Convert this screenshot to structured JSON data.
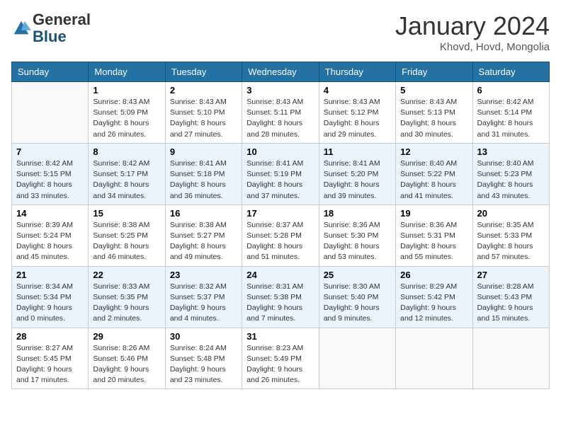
{
  "header": {
    "logo_general": "General",
    "logo_blue": "Blue",
    "month_title": "January 2024",
    "location": "Khovd, Hovd, Mongolia"
  },
  "days_of_week": [
    "Sunday",
    "Monday",
    "Tuesday",
    "Wednesday",
    "Thursday",
    "Friday",
    "Saturday"
  ],
  "weeks": [
    [
      {
        "day": "",
        "sunrise": "",
        "sunset": "",
        "daylight": ""
      },
      {
        "day": "1",
        "sunrise": "Sunrise: 8:43 AM",
        "sunset": "Sunset: 5:09 PM",
        "daylight": "Daylight: 8 hours and 26 minutes."
      },
      {
        "day": "2",
        "sunrise": "Sunrise: 8:43 AM",
        "sunset": "Sunset: 5:10 PM",
        "daylight": "Daylight: 8 hours and 27 minutes."
      },
      {
        "day": "3",
        "sunrise": "Sunrise: 8:43 AM",
        "sunset": "Sunset: 5:11 PM",
        "daylight": "Daylight: 8 hours and 28 minutes."
      },
      {
        "day": "4",
        "sunrise": "Sunrise: 8:43 AM",
        "sunset": "Sunset: 5:12 PM",
        "daylight": "Daylight: 8 hours and 29 minutes."
      },
      {
        "day": "5",
        "sunrise": "Sunrise: 8:43 AM",
        "sunset": "Sunset: 5:13 PM",
        "daylight": "Daylight: 8 hours and 30 minutes."
      },
      {
        "day": "6",
        "sunrise": "Sunrise: 8:42 AM",
        "sunset": "Sunset: 5:14 PM",
        "daylight": "Daylight: 8 hours and 31 minutes."
      }
    ],
    [
      {
        "day": "7",
        "sunrise": "Sunrise: 8:42 AM",
        "sunset": "Sunset: 5:15 PM",
        "daylight": "Daylight: 8 hours and 33 minutes."
      },
      {
        "day": "8",
        "sunrise": "Sunrise: 8:42 AM",
        "sunset": "Sunset: 5:17 PM",
        "daylight": "Daylight: 8 hours and 34 minutes."
      },
      {
        "day": "9",
        "sunrise": "Sunrise: 8:41 AM",
        "sunset": "Sunset: 5:18 PM",
        "daylight": "Daylight: 8 hours and 36 minutes."
      },
      {
        "day": "10",
        "sunrise": "Sunrise: 8:41 AM",
        "sunset": "Sunset: 5:19 PM",
        "daylight": "Daylight: 8 hours and 37 minutes."
      },
      {
        "day": "11",
        "sunrise": "Sunrise: 8:41 AM",
        "sunset": "Sunset: 5:20 PM",
        "daylight": "Daylight: 8 hours and 39 minutes."
      },
      {
        "day": "12",
        "sunrise": "Sunrise: 8:40 AM",
        "sunset": "Sunset: 5:22 PM",
        "daylight": "Daylight: 8 hours and 41 minutes."
      },
      {
        "day": "13",
        "sunrise": "Sunrise: 8:40 AM",
        "sunset": "Sunset: 5:23 PM",
        "daylight": "Daylight: 8 hours and 43 minutes."
      }
    ],
    [
      {
        "day": "14",
        "sunrise": "Sunrise: 8:39 AM",
        "sunset": "Sunset: 5:24 PM",
        "daylight": "Daylight: 8 hours and 45 minutes."
      },
      {
        "day": "15",
        "sunrise": "Sunrise: 8:38 AM",
        "sunset": "Sunset: 5:25 PM",
        "daylight": "Daylight: 8 hours and 46 minutes."
      },
      {
        "day": "16",
        "sunrise": "Sunrise: 8:38 AM",
        "sunset": "Sunset: 5:27 PM",
        "daylight": "Daylight: 8 hours and 49 minutes."
      },
      {
        "day": "17",
        "sunrise": "Sunrise: 8:37 AM",
        "sunset": "Sunset: 5:28 PM",
        "daylight": "Daylight: 8 hours and 51 minutes."
      },
      {
        "day": "18",
        "sunrise": "Sunrise: 8:36 AM",
        "sunset": "Sunset: 5:30 PM",
        "daylight": "Daylight: 8 hours and 53 minutes."
      },
      {
        "day": "19",
        "sunrise": "Sunrise: 8:36 AM",
        "sunset": "Sunset: 5:31 PM",
        "daylight": "Daylight: 8 hours and 55 minutes."
      },
      {
        "day": "20",
        "sunrise": "Sunrise: 8:35 AM",
        "sunset": "Sunset: 5:33 PM",
        "daylight": "Daylight: 8 hours and 57 minutes."
      }
    ],
    [
      {
        "day": "21",
        "sunrise": "Sunrise: 8:34 AM",
        "sunset": "Sunset: 5:34 PM",
        "daylight": "Daylight: 9 hours and 0 minutes."
      },
      {
        "day": "22",
        "sunrise": "Sunrise: 8:33 AM",
        "sunset": "Sunset: 5:35 PM",
        "daylight": "Daylight: 9 hours and 2 minutes."
      },
      {
        "day": "23",
        "sunrise": "Sunrise: 8:32 AM",
        "sunset": "Sunset: 5:37 PM",
        "daylight": "Daylight: 9 hours and 4 minutes."
      },
      {
        "day": "24",
        "sunrise": "Sunrise: 8:31 AM",
        "sunset": "Sunset: 5:38 PM",
        "daylight": "Daylight: 9 hours and 7 minutes."
      },
      {
        "day": "25",
        "sunrise": "Sunrise: 8:30 AM",
        "sunset": "Sunset: 5:40 PM",
        "daylight": "Daylight: 9 hours and 9 minutes."
      },
      {
        "day": "26",
        "sunrise": "Sunrise: 8:29 AM",
        "sunset": "Sunset: 5:42 PM",
        "daylight": "Daylight: 9 hours and 12 minutes."
      },
      {
        "day": "27",
        "sunrise": "Sunrise: 8:28 AM",
        "sunset": "Sunset: 5:43 PM",
        "daylight": "Daylight: 9 hours and 15 minutes."
      }
    ],
    [
      {
        "day": "28",
        "sunrise": "Sunrise: 8:27 AM",
        "sunset": "Sunset: 5:45 PM",
        "daylight": "Daylight: 9 hours and 17 minutes."
      },
      {
        "day": "29",
        "sunrise": "Sunrise: 8:26 AM",
        "sunset": "Sunset: 5:46 PM",
        "daylight": "Daylight: 9 hours and 20 minutes."
      },
      {
        "day": "30",
        "sunrise": "Sunrise: 8:24 AM",
        "sunset": "Sunset: 5:48 PM",
        "daylight": "Daylight: 9 hours and 23 minutes."
      },
      {
        "day": "31",
        "sunrise": "Sunrise: 8:23 AM",
        "sunset": "Sunset: 5:49 PM",
        "daylight": "Daylight: 9 hours and 26 minutes."
      },
      {
        "day": "",
        "sunrise": "",
        "sunset": "",
        "daylight": ""
      },
      {
        "day": "",
        "sunrise": "",
        "sunset": "",
        "daylight": ""
      },
      {
        "day": "",
        "sunrise": "",
        "sunset": "",
        "daylight": ""
      }
    ]
  ]
}
